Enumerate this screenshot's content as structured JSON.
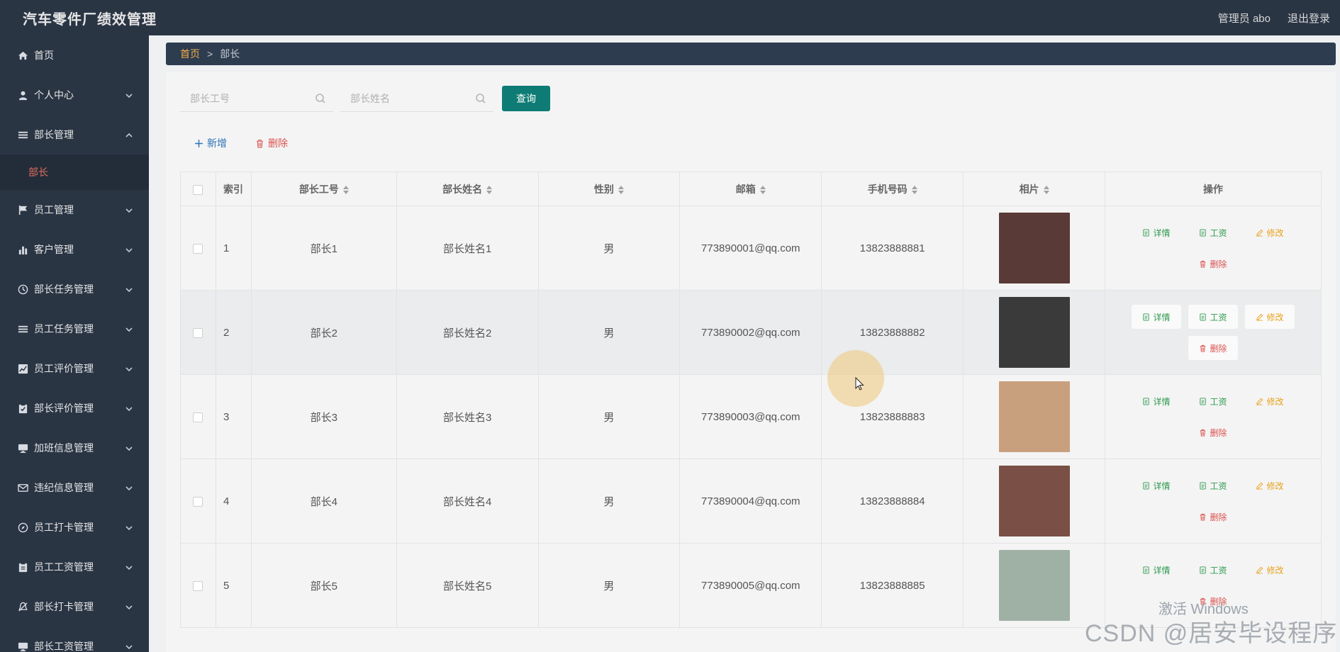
{
  "app": {
    "title": "汽车零件厂绩效管理"
  },
  "header": {
    "admin_label": "管理员 abo",
    "logout_label": "退出登录"
  },
  "sidebar": {
    "items": [
      {
        "label": "首页",
        "icon": "home-icon",
        "expandable": false
      },
      {
        "label": "个人中心",
        "icon": "user-icon",
        "expandable": true
      },
      {
        "label": "部长管理",
        "icon": "list-icon",
        "expandable": true,
        "expanded": true
      },
      {
        "label": "员工管理",
        "icon": "flag-icon",
        "expandable": true
      },
      {
        "label": "客户管理",
        "icon": "bar-chart-icon",
        "expandable": true
      },
      {
        "label": "部长任务管理",
        "icon": "clock-icon",
        "expandable": true
      },
      {
        "label": "员工任务管理",
        "icon": "list-icon",
        "expandable": true
      },
      {
        "label": "员工评价管理",
        "icon": "line-chart-icon",
        "expandable": true
      },
      {
        "label": "部长评价管理",
        "icon": "clipboard-icon",
        "expandable": true
      },
      {
        "label": "加班信息管理",
        "icon": "monitor-icon",
        "expandable": true
      },
      {
        "label": "违纪信息管理",
        "icon": "mail-icon",
        "expandable": true
      },
      {
        "label": "员工打卡管理",
        "icon": "compass-icon",
        "expandable": true
      },
      {
        "label": "员工工资管理",
        "icon": "clipboard-icon",
        "expandable": true
      },
      {
        "label": "部长打卡管理",
        "icon": "bell-icon",
        "expandable": true
      },
      {
        "label": "部长工资管理",
        "icon": "monitor-icon",
        "expandable": true
      }
    ],
    "sub_item": "部长"
  },
  "breadcrumb": {
    "home": "首页",
    "separator": ">",
    "current": "部长"
  },
  "search": {
    "id_placeholder": "部长工号",
    "name_placeholder": "部长姓名",
    "query_label": "查询"
  },
  "actions": {
    "add_label": "新增",
    "delete_label": "删除"
  },
  "table": {
    "headers": [
      "索引",
      "部长工号",
      "部长姓名",
      "性别",
      "邮箱",
      "手机号码",
      "相片",
      "操作"
    ],
    "op_labels": {
      "detail": "详情",
      "salary": "工资",
      "edit": "修改",
      "delete": "删除"
    },
    "rows": [
      {
        "index": "1",
        "id": "部长1",
        "name": "部长姓名1",
        "gender": "男",
        "email": "773890001@qq.com",
        "phone": "13823888881",
        "photo_color": "#5a3a36"
      },
      {
        "index": "2",
        "id": "部长2",
        "name": "部长姓名2",
        "gender": "男",
        "email": "773890002@qq.com",
        "phone": "13823888882",
        "photo_color": "#3a3a3a"
      },
      {
        "index": "3",
        "id": "部长3",
        "name": "部长姓名3",
        "gender": "男",
        "email": "773890003@qq.com",
        "phone": "13823888883",
        "photo_color": "#c9a07e"
      },
      {
        "index": "4",
        "id": "部长4",
        "name": "部长姓名4",
        "gender": "男",
        "email": "773890004@qq.com",
        "phone": "13823888884",
        "photo_color": "#7a4f45"
      },
      {
        "index": "5",
        "id": "部长5",
        "name": "部长姓名5",
        "gender": "男",
        "email": "773890005@qq.com",
        "phone": "13823888885",
        "photo_color": "#9fb0a4"
      }
    ]
  },
  "watermark": {
    "activate": "激活 Windows",
    "csdn": "CSDN @居安毕设程序"
  },
  "colors": {
    "sidebar_bg": "#2a3544",
    "accent": "#0e7c74",
    "active_sub": "#e06c5a"
  }
}
